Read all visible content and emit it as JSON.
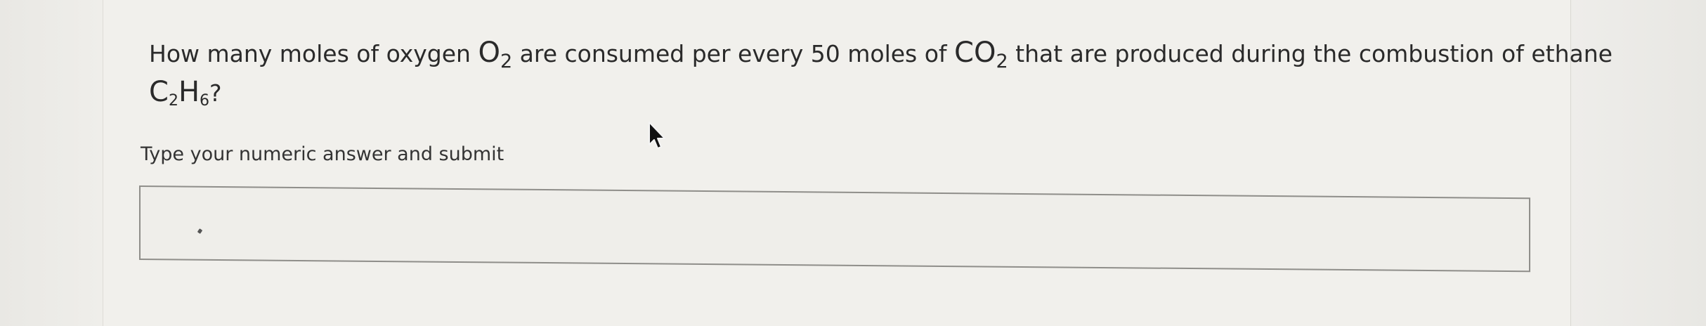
{
  "question": {
    "intro": "How many moles of oxygen ",
    "oxygen_base": "O",
    "oxygen_sub": "2",
    "middle": " are consumed per every 50 moles of ",
    "co2_base": "CO",
    "co2_sub": "2",
    "tail": " that are produced during the combustion of ethane",
    "ethane_c": "C",
    "ethane_c_sub": "2",
    "ethane_h": "H",
    "ethane_h_sub": "6",
    "end": "?"
  },
  "instruction": "Type your numeric answer and submit",
  "answer": {
    "value": "",
    "placeholder": ""
  },
  "icons": {
    "cursor": "mouse-pointer-icon"
  }
}
